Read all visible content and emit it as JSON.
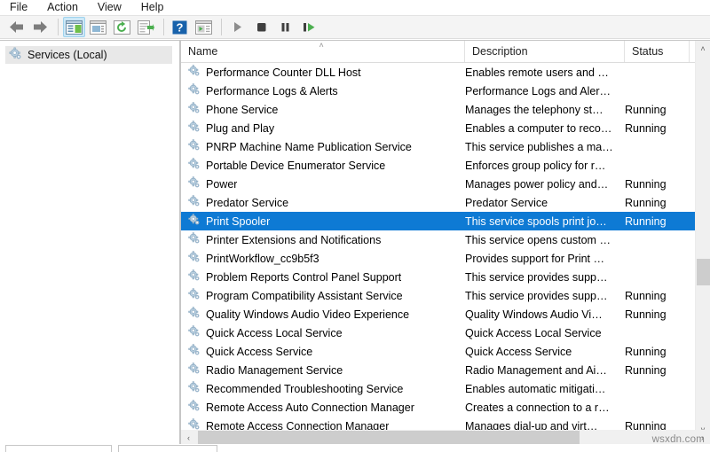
{
  "menubar": {
    "items": [
      {
        "label": "File",
        "name": "menu-file"
      },
      {
        "label": "Action",
        "name": "menu-action"
      },
      {
        "label": "View",
        "name": "menu-view"
      },
      {
        "label": "Help",
        "name": "menu-help"
      }
    ]
  },
  "toolbar": {
    "buttons": [
      {
        "name": "back-icon",
        "tooltip": "Back"
      },
      {
        "name": "forward-icon",
        "tooltip": "Forward"
      },
      {
        "name": "show-hide-tree-icon",
        "tooltip": "Show/Hide Console Tree",
        "active": true
      },
      {
        "name": "properties-icon",
        "tooltip": "Properties"
      },
      {
        "name": "refresh-icon",
        "tooltip": "Refresh"
      },
      {
        "name": "export-list-icon",
        "tooltip": "Export List"
      },
      {
        "name": "help-icon",
        "tooltip": "Help"
      },
      {
        "name": "show-action-pane-icon",
        "tooltip": "Show/Hide Action Pane"
      },
      {
        "name": "start-service-icon",
        "tooltip": "Start Service"
      },
      {
        "name": "stop-service-icon",
        "tooltip": "Stop Service"
      },
      {
        "name": "pause-service-icon",
        "tooltip": "Pause Service"
      },
      {
        "name": "restart-service-icon",
        "tooltip": "Restart Service"
      }
    ]
  },
  "tree": {
    "root_label": "Services (Local)",
    "root_icon": "services-gear-icon"
  },
  "columns": [
    {
      "key": "name",
      "label": "Name",
      "sorted": true
    },
    {
      "key": "desc",
      "label": "Description",
      "sorted": false
    },
    {
      "key": "status",
      "label": "Status",
      "sorted": false
    }
  ],
  "rows": [
    {
      "name": "Performance Counter DLL Host",
      "desc": "Enables remote users and …",
      "status": "",
      "selected": false
    },
    {
      "name": "Performance Logs & Alerts",
      "desc": "Performance Logs and Aler…",
      "status": "",
      "selected": false
    },
    {
      "name": "Phone Service",
      "desc": "Manages the telephony st…",
      "status": "Running",
      "selected": false
    },
    {
      "name": "Plug and Play",
      "desc": "Enables a computer to reco…",
      "status": "Running",
      "selected": false
    },
    {
      "name": "PNRP Machine Name Publication Service",
      "desc": "This service publishes a ma…",
      "status": "",
      "selected": false
    },
    {
      "name": "Portable Device Enumerator Service",
      "desc": "Enforces group policy for r…",
      "status": "",
      "selected": false
    },
    {
      "name": "Power",
      "desc": "Manages power policy and…",
      "status": "Running",
      "selected": false
    },
    {
      "name": "Predator Service",
      "desc": "Predator Service",
      "status": "Running",
      "selected": false
    },
    {
      "name": "Print Spooler",
      "desc": "This service spools print jo…",
      "status": "Running",
      "selected": true
    },
    {
      "name": "Printer Extensions and Notifications",
      "desc": "This service opens custom …",
      "status": "",
      "selected": false
    },
    {
      "name": "PrintWorkflow_cc9b5f3",
      "desc": "Provides support for Print …",
      "status": "",
      "selected": false
    },
    {
      "name": "Problem Reports Control Panel Support",
      "desc": "This service provides supp…",
      "status": "",
      "selected": false
    },
    {
      "name": "Program Compatibility Assistant Service",
      "desc": "This service provides supp…",
      "status": "Running",
      "selected": false
    },
    {
      "name": "Quality Windows Audio Video Experience",
      "desc": "Quality Windows Audio Vi…",
      "status": "Running",
      "selected": false
    },
    {
      "name": "Quick Access Local Service",
      "desc": "Quick Access Local Service",
      "status": "",
      "selected": false
    },
    {
      "name": "Quick Access Service",
      "desc": "Quick Access Service",
      "status": "Running",
      "selected": false
    },
    {
      "name": "Radio Management Service",
      "desc": "Radio Management and Ai…",
      "status": "Running",
      "selected": false
    },
    {
      "name": "Recommended Troubleshooting Service",
      "desc": "Enables automatic mitigati…",
      "status": "",
      "selected": false
    },
    {
      "name": "Remote Access Auto Connection Manager",
      "desc": "Creates a connection to a r…",
      "status": "",
      "selected": false
    },
    {
      "name": "Remote Access Connection Manager",
      "desc": "Manages dial-up and virt…",
      "status": "Running",
      "selected": false
    }
  ],
  "scrollbars": {
    "v_up_glyph": "˄",
    "v_down_glyph": "˅",
    "h_left_glyph": "‹",
    "h_right_glyph": "›"
  },
  "header_sort_glyph": "˄",
  "watermark": "wsxdn.com",
  "colors": {
    "selection_blue": "#0e7ad4",
    "toolbar_bg": "#f4f4f4",
    "active_button_bg": "#cde8f7",
    "scrollbar_thumb": "#cdcdcd"
  }
}
